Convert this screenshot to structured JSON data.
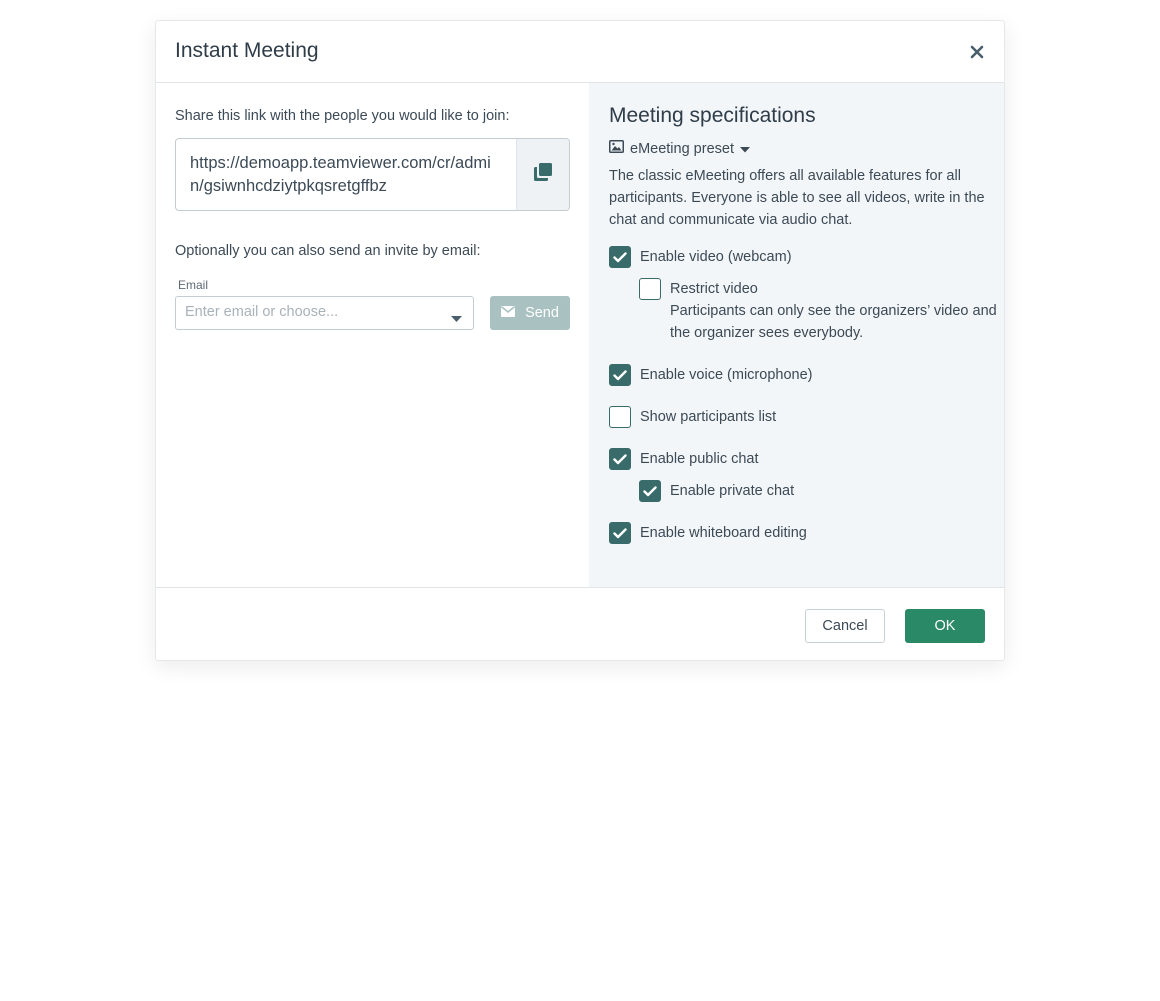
{
  "dialog": {
    "title": "Instant Meeting",
    "close_icon": "close-icon"
  },
  "share": {
    "prompt": "Share this link with the people you would like to join:",
    "link": "https://demoapp.teamviewer.com/cr/admin/gsiwnhcdziytpkqsretgffbz",
    "copy_icon": "copy-icon"
  },
  "invite": {
    "prompt": "Optionally you can also send an invite by email:",
    "email_label": "Email",
    "email_placeholder": "Enter email or choose...",
    "email_value": "",
    "send_label": "Send",
    "send_icon": "envelope-icon"
  },
  "specs": {
    "title": "Meeting specifications",
    "preset_label": "eMeeting preset",
    "preset_icon": "image-icon",
    "description": "The classic eMeeting offers all available features for all participants. Everyone is able to see all videos, write in the chat and communicate via audio chat.",
    "options": {
      "video": {
        "label": "Enable video (webcam)",
        "checked": true
      },
      "restrict_video": {
        "label": "Restrict video",
        "description": "Participants can only see the organizers’ video and the organizer sees everybody.",
        "checked": false
      },
      "voice": {
        "label": "Enable voice (microphone)",
        "checked": true
      },
      "participants_list": {
        "label": "Show participants list",
        "checked": false
      },
      "public_chat": {
        "label": "Enable public chat",
        "checked": true
      },
      "private_chat": {
        "label": "Enable private chat",
        "checked": true
      },
      "whiteboard": {
        "label": "Enable whiteboard editing",
        "checked": true
      }
    }
  },
  "footer": {
    "cancel_label": "Cancel",
    "ok_label": "OK"
  },
  "colors": {
    "accent": "#2a8a67",
    "checkbox": "#3a6b6b",
    "send_disabled": "#a9c1c0",
    "right_pane_bg": "#f3f6f8"
  }
}
